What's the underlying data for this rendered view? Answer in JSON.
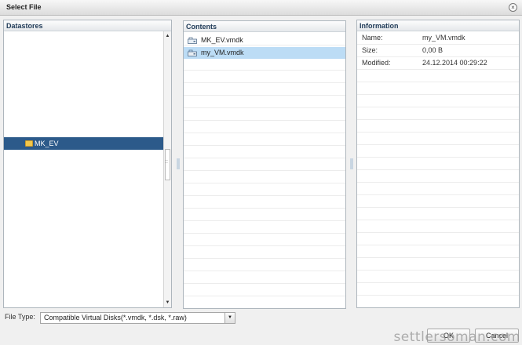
{
  "window": {
    "title": "Select File"
  },
  "datastores": {
    "header": "Datastores",
    "items": [
      {
        "label": "MK_EV",
        "selected": true
      }
    ]
  },
  "contents": {
    "header": "Contents",
    "items": [
      {
        "label": "MK_EV.vmdk",
        "selected": false
      },
      {
        "label": "my_VM.vmdk",
        "selected": true
      }
    ]
  },
  "information": {
    "header": "Information",
    "fields": [
      {
        "key": "Name:",
        "value": "my_VM.vmdk"
      },
      {
        "key": "Size:",
        "value": "0,00 B"
      },
      {
        "key": "Modified:",
        "value": "24.12.2014 00:29:22"
      }
    ]
  },
  "file_type": {
    "label": "File Type:",
    "selected": "Compatible Virtual Disks(*.vmdk, *.dsk, *.raw)"
  },
  "buttons": {
    "ok": "OK",
    "cancel": "Cancel"
  },
  "watermark": "settlersoman.com",
  "colors": {
    "selection_dark": "#2c5a8a",
    "selection_light": "#bcdcf5"
  }
}
